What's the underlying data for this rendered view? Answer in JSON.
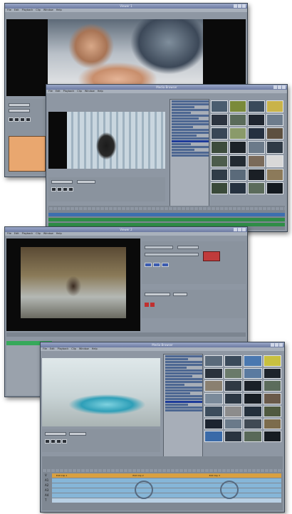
{
  "windows": [
    {
      "title": "Viewer 1",
      "menu": [
        "File",
        "Edit",
        "Playback",
        "Clip",
        "Window",
        "Help"
      ]
    },
    {
      "title": "Media Browser",
      "menu": [
        "File",
        "Edit",
        "Playback",
        "Clip",
        "Window",
        "Help"
      ]
    },
    {
      "title": "Viewer 2",
      "menu": [
        "File",
        "Edit",
        "Playback",
        "Clip",
        "Window",
        "Help"
      ]
    },
    {
      "title": "Media Browser",
      "menu": [
        "File",
        "Edit",
        "Playback",
        "Clip",
        "Window",
        "Help"
      ]
    }
  ],
  "timeline": {
    "track_labels": [
      "V",
      "A1",
      "A2",
      "A3",
      "A4",
      "T"
    ],
    "clip_names": [
      "Edit Clip 1",
      "Edit Clip 2",
      "Edit Clip 3"
    ]
  },
  "subtitle": "",
  "colors": {
    "window_bg": "#8e97a3",
    "titlebar": "#6c7aa2",
    "clip_orange": "#d9a040",
    "audio_blue": "#86b6d8",
    "track_green": "#2f8d47",
    "selection": "#1d3b9a"
  }
}
